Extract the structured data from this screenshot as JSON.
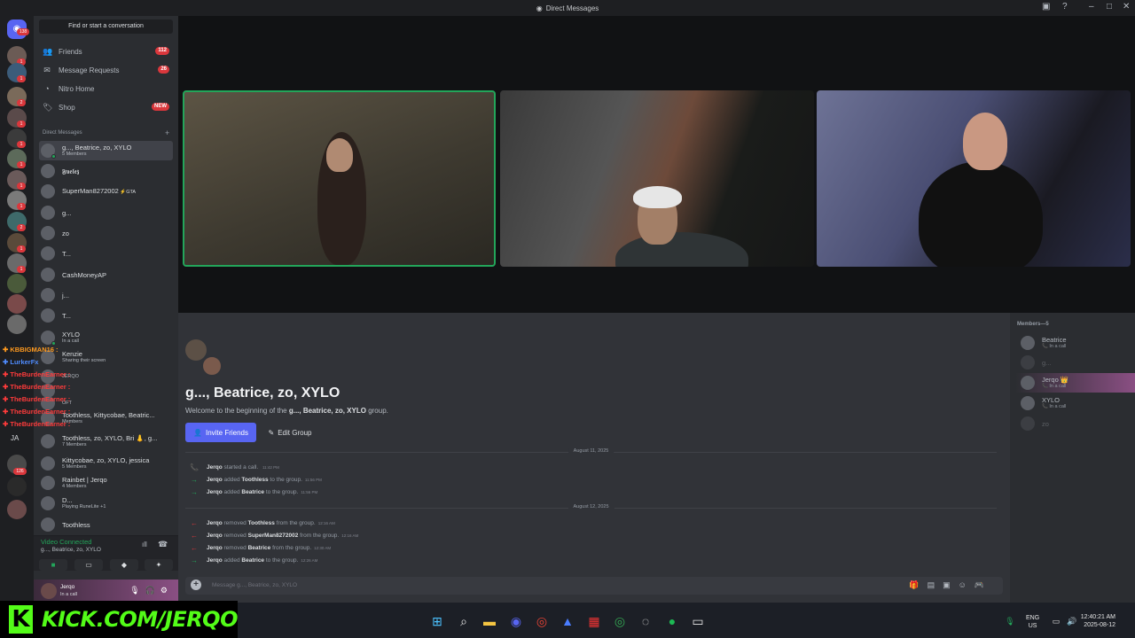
{
  "window": {
    "title": "Direct Messages"
  },
  "guilds": {
    "home_badge": "138",
    "badges": [
      "1",
      "1",
      "2",
      "1",
      "1",
      "1",
      "1",
      "1",
      "2",
      "1",
      "1"
    ],
    "ja_label": "JA",
    "ja_badge": "126"
  },
  "sidebar": {
    "find_placeholder": "Find or start a conversation",
    "nav": [
      {
        "label": "Friends",
        "badge": "112",
        "icon": "friends-icon"
      },
      {
        "label": "Message Requests",
        "badge": "26",
        "icon": "mail-icon"
      },
      {
        "label": "Nitro Home",
        "badge": "",
        "icon": "nitro-icon"
      },
      {
        "label": "Shop",
        "badge": "NEW",
        "icon": "shop-icon"
      }
    ],
    "dm_header": "Direct Messages",
    "dms": [
      {
        "name": "g..., Beatrice, zo, XYLO",
        "sub": "5 Members"
      },
      {
        "name": "𝕱𝖚𝖊𝖑𝖊𝖟",
        "sub": ""
      },
      {
        "name": "SuperMan8272002",
        "sub": "",
        "tag": "GTA"
      },
      {
        "name": "g...",
        "sub": ""
      },
      {
        "name": "zo",
        "sub": ""
      },
      {
        "name": "T...",
        "sub": ""
      },
      {
        "name": "CashMoneyAP",
        "sub": ""
      },
      {
        "name": "j...",
        "sub": ""
      },
      {
        "name": "T...",
        "sub": ""
      },
      {
        "name": "XYLO",
        "sub": "In a call"
      },
      {
        "name": "Kenzie",
        "sub": "Sharing their screen"
      },
      {
        "name": "",
        "sub": "JERQO"
      },
      {
        "name": "",
        "sub": ""
      },
      {
        "name": "",
        "sub": "OFT"
      },
      {
        "name": "Toothless, Kittycobae, Beatric...",
        "sub": "Members"
      },
      {
        "name": "Toothless, zo, XYLO, Bri 👃, g...",
        "sub": "7 Members"
      },
      {
        "name": "Kittycobae, zo, XYLO, jessica",
        "sub": "5 Members"
      },
      {
        "name": "Rainbet | Jerqo",
        "sub": "4 Members"
      },
      {
        "name": "D...",
        "sub": "Playing RuneLite +1"
      },
      {
        "name": "Toothless",
        "sub": ""
      }
    ],
    "voice": {
      "status": "Video Connected",
      "channel": "g..., Beatrice, zo, XYLO"
    },
    "user": {
      "name": "Jerqo",
      "status": "In a call"
    }
  },
  "chat_overlay": [
    {
      "text": "KBBIGMAN16 :",
      "color": "#ff9a1f"
    },
    {
      "text": "LurkerFx",
      "color": "#4f8cff"
    },
    {
      "text": "TheBurdenEarner :",
      "color": "#ff3b3b"
    },
    {
      "text": "TheBurdenEarner :",
      "color": "#ff3b3b"
    },
    {
      "text": "TheBurdenEarner :",
      "color": "#ff3b3b"
    },
    {
      "text": "TheBurdenEarner :",
      "color": "#ff3b3b"
    },
    {
      "text": "TheBurdenEarner :",
      "color": "#ff3b3b"
    }
  ],
  "chat": {
    "group_title": "g..., Beatrice, zo, XYLO",
    "welcome_prefix": "Welcome to the beginning of the ",
    "welcome_group": "g..., Beatrice, zo, XYLO",
    "welcome_suffix": " group.",
    "invite_label": "Invite Friends",
    "edit_label": "Edit Group",
    "date1": "August 11, 2025",
    "events1": [
      {
        "actor": "Jerqo",
        "action": "started a call.",
        "target": "",
        "rest": "",
        "time": "11:42 PM",
        "kind": "call"
      },
      {
        "actor": "Jerqo",
        "action": "added",
        "target": "Toothless",
        "rest": "to the group.",
        "time": "11:56 PM",
        "kind": "add"
      },
      {
        "actor": "Jerqo",
        "action": "added",
        "target": "Beatrice",
        "rest": "to the group.",
        "time": "11:56 PM",
        "kind": "add"
      }
    ],
    "date2": "August 12, 2025",
    "events2": [
      {
        "actor": "Jerqo",
        "action": "removed",
        "target": "Toothless",
        "rest": "from the group.",
        "time": "12:16 AM",
        "kind": "remove"
      },
      {
        "actor": "Jerqo",
        "action": "removed",
        "target": "SuperMan8272002",
        "rest": "from the group.",
        "time": "12:16 AM",
        "kind": "remove"
      },
      {
        "actor": "Jerqo",
        "action": "removed",
        "target": "Beatrice",
        "rest": "from the group.",
        "time": "12:30 AM",
        "kind": "remove"
      },
      {
        "actor": "Jerqo",
        "action": "added",
        "target": "Beatrice",
        "rest": "to the group.",
        "time": "12:26 AM",
        "kind": "add"
      }
    ],
    "input_placeholder": "Message g..., Beatrice, zo, XYLO"
  },
  "members": {
    "header": "Members—5",
    "list": [
      {
        "name": "Beatrice",
        "sub": "In a call"
      },
      {
        "name": "g...",
        "sub": ""
      },
      {
        "name": "Jerqo 👑",
        "sub": "In a call"
      },
      {
        "name": "XYLO",
        "sub": "In a call"
      },
      {
        "name": "zo",
        "sub": ""
      }
    ]
  },
  "taskbar": {
    "lang": "ENG",
    "region": "US",
    "time": "12:40:21 AM",
    "date": "2025-08-12"
  },
  "overlay_brand": {
    "k": "K",
    "url": "KICK.COM/JERQO"
  },
  "colors": {
    "accent": "#5865f2",
    "online": "#23a55a",
    "badge": "#da373c",
    "kick": "#53fc18"
  }
}
